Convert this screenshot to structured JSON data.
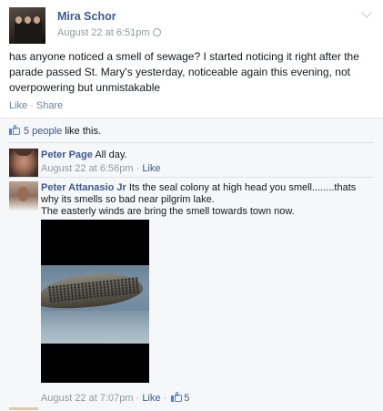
{
  "post": {
    "author": "Mira Schor",
    "timestamp": "August 22 at 6:51pm",
    "text": "has anyone noticed a smell of sewage? I started noticing it right after the parade passed St. Mary's yesterday, noticeable again this evening, not overpowering but unmistakable",
    "actions": {
      "like": "Like",
      "separator": "·",
      "share": "Share"
    },
    "menu_icon": "chevron-down-icon",
    "privacy_icon": "globe-icon"
  },
  "likes": {
    "count_text": "5 people",
    "suffix": " like this.",
    "icon": "thumbs-up-icon"
  },
  "comments": [
    {
      "author": "Peter Page",
      "text": "All day.",
      "timestamp": "August 22 at 6:56pm",
      "separator": "·",
      "like_label": "Like"
    },
    {
      "author": "Peter Attanasio Jr",
      "text_line1": "Its the seal colony at high head you smell........thats why its smells so bad near pilgrim lake.",
      "text_line2": "The easterly winds are bring the smell towards town now.",
      "timestamp": "August 22 at 7:07pm",
      "separator": "·",
      "like_label": "Like",
      "like_count": "5"
    }
  ],
  "colors": {
    "link": "#3b5998",
    "meta": "#9197a3",
    "ufi_background": "#f6f7f9"
  }
}
